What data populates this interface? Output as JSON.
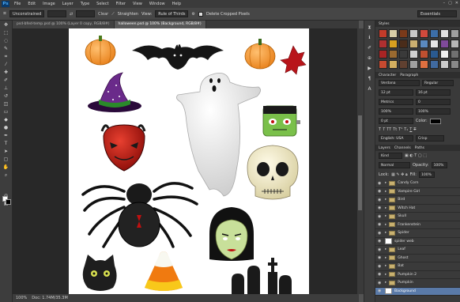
{
  "app": {
    "logo": "Ps"
  },
  "menu": [
    "File",
    "Edit",
    "Image",
    "Layer",
    "Type",
    "Select",
    "Filter",
    "View",
    "Window",
    "Help"
  ],
  "window_controls": [
    "–",
    "▢",
    "✕"
  ],
  "options_bar": {
    "preset": "Unconstrained",
    "straighten_label": "Straighten",
    "view_label": "View:",
    "view_value": "Rule of Thirds",
    "delete_cropped_label": "Delete Cropped Pixels",
    "workspace": "Essentials"
  },
  "tabs": [
    {
      "label": "psd-bfed-temp.psd @ 100% (Layer 0 copy, RGB/8#)"
    },
    {
      "label": "halloween.psd @ 100% (Background, RGB/8#)"
    }
  ],
  "status": {
    "zoom": "100%",
    "doc": "Doc: 1.74M/35.3M"
  },
  "styles_panel": {
    "title": "Styles",
    "swatches": [
      "#c23b2a",
      "#d9cfa8",
      "#7a3a1a",
      "#c8c8c8",
      "#d24a3c",
      "#3c6ea8",
      "#e0e0e0",
      "#9e9e9e",
      "#b03030",
      "#d6a020",
      "#4a2c1a",
      "#cdb070",
      "#5a8ac0",
      "#e6e6e6",
      "#7f4a9a",
      "#b8b8b8",
      "#a82424",
      "#9a6a30",
      "#3a3a3a",
      "#d0d0d0",
      "#c05030",
      "#2a5a90",
      "#f0f0f0",
      "#707070",
      "#c84a30",
      "#d4b060",
      "#604030",
      "#a0a0a0",
      "#e07040",
      "#406aa0",
      "#cacaca",
      "#888888"
    ]
  },
  "character_panel": {
    "tabs": [
      "Character",
      "Paragraph"
    ],
    "font": "Verdana",
    "style": "Regular",
    "size": "12 pt",
    "leading": "16 pt",
    "kerning": "Metrics",
    "tracking": "0",
    "vscale": "100%",
    "hscale": "100%",
    "baseline": "0 pt",
    "color_label": "Color:",
    "language": "English: USA",
    "aa": "Crisp"
  },
  "layers_panel": {
    "tabs": [
      "Layers",
      "Channels",
      "Paths"
    ],
    "kind": "Kind",
    "blend": "Normal",
    "opacity_label": "Opacity:",
    "opacity": "100%",
    "lock_label": "Lock:",
    "fill_label": "Fill:",
    "fill": "100%",
    "layers": [
      {
        "name": "Candy Corn",
        "type": "folder"
      },
      {
        "name": "Vampire Girl",
        "type": "folder"
      },
      {
        "name": "Bird",
        "type": "folder"
      },
      {
        "name": "Witch Hat",
        "type": "folder"
      },
      {
        "name": "Skull",
        "type": "folder"
      },
      {
        "name": "Frankenstein",
        "type": "folder"
      },
      {
        "name": "Spider",
        "type": "folder"
      },
      {
        "name": "spider web",
        "type": "layer"
      },
      {
        "name": "Leaf",
        "type": "folder"
      },
      {
        "name": "Ghost",
        "type": "folder"
      },
      {
        "name": "Bat",
        "type": "folder"
      },
      {
        "name": "Pumpkin 2",
        "type": "folder"
      },
      {
        "name": "Pumpkin",
        "type": "folder"
      },
      {
        "name": "Background",
        "type": "background"
      }
    ]
  },
  "colors": {
    "pumpkin": "#f0921e",
    "devil": "#c41a14",
    "ghost": "#e4e4e4",
    "hat": "#6a2a8a",
    "frank": "#7ac04a",
    "skull": "#f0e8c8",
    "vampire_skin": "#c8e09a",
    "candy_yellow": "#f8c81a",
    "candy_orange": "#f07a10"
  }
}
